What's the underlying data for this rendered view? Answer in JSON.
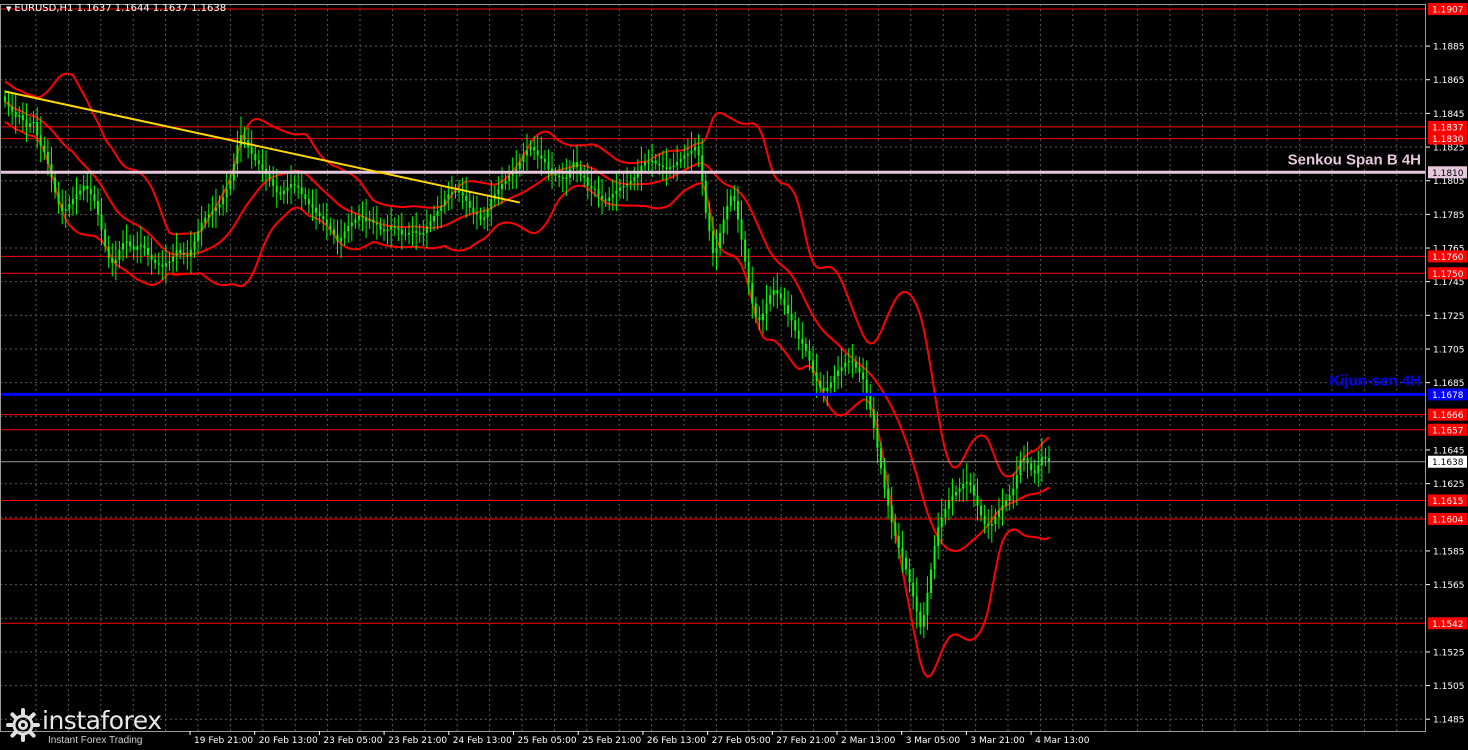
{
  "header": {
    "text": "EURUSD,H1  1.1637 1.1644 1.1637 1.1638"
  },
  "logo": {
    "brand": "instaforex",
    "tagline": "Instant Forex Trading"
  },
  "colors": {
    "background": "#000000",
    "grid": "#5a5a5a",
    "candle": "#00ff00",
    "bands": "#ff0000",
    "levels": "#ff0000",
    "trendline": "#ffd700",
    "kijun": "#0000ff",
    "senkou": "#e6c8dc",
    "axis_text": "#ffffff"
  },
  "chart_data": {
    "type": "candlestick",
    "symbol": "EURUSD",
    "timeframe": "H1",
    "ylim": [
      1.1478,
      1.191
    ],
    "x_ticks": [
      "19 Feb 21:00",
      "20 Feb 13:00",
      "23 Feb 05:00",
      "23 Feb 21:00",
      "24 Feb 13:00",
      "25 Feb 05:00",
      "25 Feb 21:00",
      "26 Feb 13:00",
      "27 Feb 05:00",
      "27 Feb 21:00",
      "2 Mar 13:00",
      "3 Mar 05:00",
      "3 Mar 21:00",
      "4 Mar 13:00"
    ],
    "y_ticks": [
      "1.1885",
      "1.1865",
      "1.1845",
      "1.1825",
      "1.1805",
      "1.1785",
      "1.1765",
      "1.1745",
      "1.1725",
      "1.1705",
      "1.1685",
      "1.1645",
      "1.1625",
      "1.1585",
      "1.1565",
      "1.1525",
      "1.1505",
      "1.1485"
    ],
    "levels": [
      {
        "value": 1.1907,
        "label": "1.1907"
      },
      {
        "value": 1.1837,
        "label": "1.1837"
      },
      {
        "value": 1.183,
        "label": "1.1830"
      },
      {
        "value": 1.176,
        "label": "1.1760"
      },
      {
        "value": 1.175,
        "label": "1.1750"
      },
      {
        "value": 1.1666,
        "label": "1.1666"
      },
      {
        "value": 1.1657,
        "label": "1.1657"
      },
      {
        "value": 1.1615,
        "label": "1.1615"
      },
      {
        "value": 1.1604,
        "label": "1.1604"
      },
      {
        "value": 1.1542,
        "label": "1.1542"
      }
    ],
    "senkou_b": {
      "value": 1.181,
      "price_label": "1.1810",
      "name": "Senkou Span B 4H"
    },
    "kijun": {
      "value": 1.1678,
      "price_label": "1.1678",
      "name": "Kijun-sen 4H"
    },
    "current_price": {
      "value": 1.1638,
      "label": "1.1638"
    },
    "trendline": {
      "from_index": 0,
      "from_value": 1.1858,
      "to_index": 144,
      "to_value": 1.1792
    },
    "close": [
      1.1852,
      1.1849,
      1.1846,
      1.1843,
      1.1844,
      1.1841,
      1.1837,
      1.1839,
      1.184,
      1.1832,
      1.1826,
      1.1822,
      1.1815,
      1.1807,
      1.1798,
      1.1791,
      1.1787,
      1.1788,
      1.1791,
      1.1794,
      1.1797,
      1.1799,
      1.1802,
      1.18,
      1.1797,
      1.1793,
      1.1785,
      1.1776,
      1.1766,
      1.1759,
      1.1756,
      1.1758,
      1.1764,
      1.1768,
      1.1769,
      1.1766,
      1.1764,
      1.1766,
      1.1767,
      1.1765,
      1.1761,
      1.1758,
      1.1756,
      1.1755,
      1.1754,
      1.1756,
      1.1757,
      1.176,
      1.1764,
      1.1762,
      1.1761,
      1.176,
      1.1764,
      1.1769,
      1.1775,
      1.178,
      1.1783,
      1.1785,
      1.1787,
      1.1789,
      1.1791,
      1.1795,
      1.18,
      1.1805,
      1.1815,
      1.1826,
      1.1832,
      1.1829,
      1.1825,
      1.1821,
      1.1817,
      1.1815,
      1.1812,
      1.1809,
      1.1806,
      1.1802,
      1.1798,
      1.1797,
      1.1799,
      1.1801,
      1.1803,
      1.1802,
      1.1801,
      1.1797,
      1.1794,
      1.1791,
      1.1789,
      1.1786,
      1.1784,
      1.1782,
      1.1779,
      1.1776,
      1.1773,
      1.1769,
      1.1771,
      1.1775,
      1.1778,
      1.178,
      1.1782,
      1.1784,
      1.1783,
      1.1781,
      1.1782,
      1.178,
      1.1779,
      1.1776,
      1.1775,
      1.1776,
      1.1778,
      1.1777,
      1.1776,
      1.1773,
      1.1773,
      1.1774,
      1.1775,
      1.1774,
      1.1773,
      1.1774,
      1.1778,
      1.1781,
      1.1784,
      1.1787,
      1.179,
      1.1794,
      1.1797,
      1.1798,
      1.1799,
      1.1798,
      1.1796,
      1.1793,
      1.1789,
      1.1786,
      1.1785,
      1.1782,
      1.1783,
      1.1788,
      1.1794,
      1.1797,
      1.18,
      1.1803,
      1.1805,
      1.1808,
      1.181,
      1.1812,
      1.1816,
      1.182,
      1.1823,
      1.1825,
      1.1823,
      1.182,
      1.1818,
      1.1816,
      1.1812,
      1.1809,
      1.1808,
      1.1807,
      1.1806,
      1.1807,
      1.1812,
      1.1816,
      1.1813,
      1.1808,
      1.1807,
      1.1802,
      1.18,
      1.18,
      1.1796,
      1.1794,
      1.1793,
      1.1795,
      1.1797,
      1.1799,
      1.1801,
      1.1802,
      1.1803,
      1.1805,
      1.1807,
      1.1809,
      1.1814,
      1.1816,
      1.1816,
      1.1817,
      1.1815,
      1.1814,
      1.1813,
      1.1812,
      1.1813,
      1.1814,
      1.1816,
      1.1818,
      1.182,
      1.1821,
      1.1823,
      1.1825,
      1.182,
      1.1805,
      1.1786,
      1.1775,
      1.1762,
      1.1765,
      1.1774,
      1.1782,
      1.179,
      1.1796,
      1.1793,
      1.1782,
      1.177,
      1.1757,
      1.1744,
      1.1732,
      1.1724,
      1.1722,
      1.1726,
      1.1732,
      1.1737,
      1.174,
      1.1738,
      1.1735,
      1.1731,
      1.1726,
      1.1722,
      1.1716,
      1.1711,
      1.1708,
      1.1704,
      1.1698,
      1.1691,
      1.1686,
      1.1682,
      1.168,
      1.1682,
      1.1685,
      1.1689,
      1.1692,
      1.1694,
      1.1697,
      1.1698,
      1.1697,
      1.1694,
      1.1691,
      1.1687,
      1.1679,
      1.1669,
      1.1658,
      1.1646,
      1.1634,
      1.1622,
      1.1612,
      1.1602,
      1.1594,
      1.1587,
      1.1581,
      1.1574,
      1.1566,
      1.1558,
      1.1549,
      1.154,
      1.1547,
      1.156,
      1.1574,
      1.1588,
      1.1599,
      1.1605,
      1.161,
      1.1615,
      1.1618,
      1.162,
      1.1622,
      1.1625,
      1.1626,
      1.1624,
      1.1618,
      1.1612,
      1.1606,
      1.1601,
      1.16,
      1.1601,
      1.1605,
      1.1609,
      1.1612,
      1.1615,
      1.1618,
      1.1622,
      1.163,
      1.1639,
      1.164,
      1.1637,
      1.1633,
      1.1631,
      1.1636,
      1.1641,
      1.164,
      1.1638
    ]
  }
}
